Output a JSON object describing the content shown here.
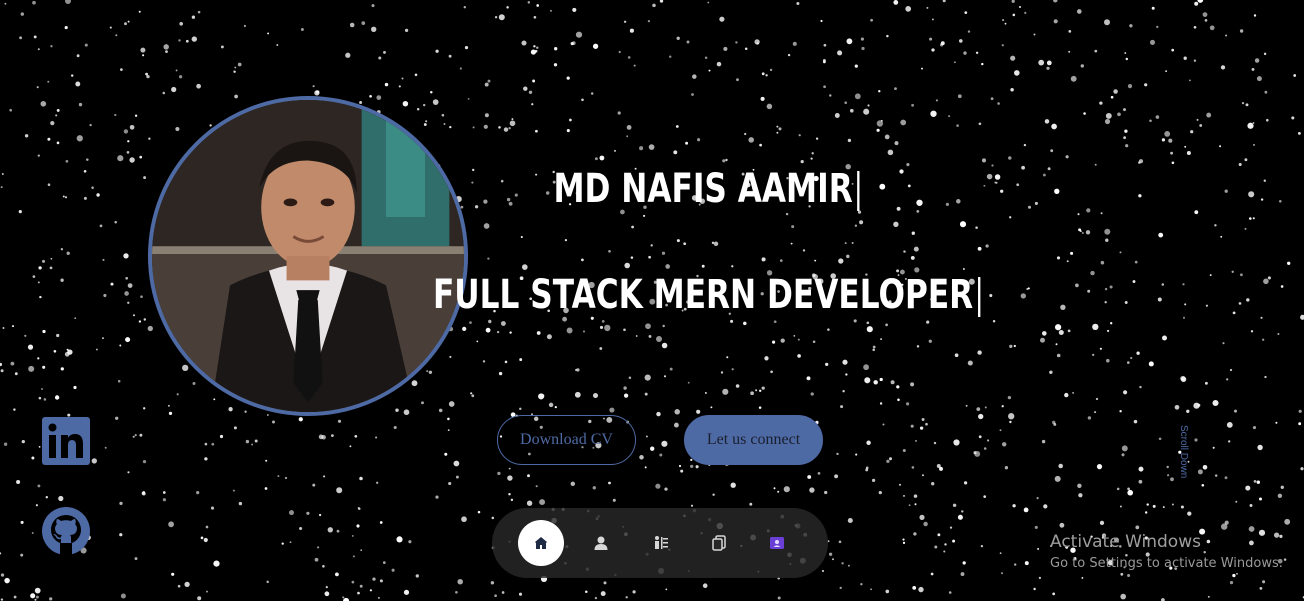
{
  "hero": {
    "name": "MD NAFIS AAMIR",
    "role": "FULL STACK MERN DEVELOPER"
  },
  "buttons": {
    "download_cv": "Download CV",
    "connect": "Let us connect"
  },
  "side": {
    "scroll_down": "Scroll Down"
  },
  "nav": {
    "items": [
      {
        "icon": "home-icon",
        "active": true
      },
      {
        "icon": "user-icon",
        "active": false
      },
      {
        "icon": "experience-icon",
        "active": false
      },
      {
        "icon": "portfolio-icon",
        "active": false
      },
      {
        "icon": "contact-icon",
        "active": false
      }
    ]
  },
  "social": [
    {
      "icon": "linkedin-icon"
    },
    {
      "icon": "github-icon"
    }
  ],
  "watermark": {
    "title": "Activate Windows",
    "subtitle": "Go to Settings to activate Windows."
  },
  "colors": {
    "accent": "#4e6aa5",
    "purple": "#6a3fd6",
    "background": "#000000"
  }
}
